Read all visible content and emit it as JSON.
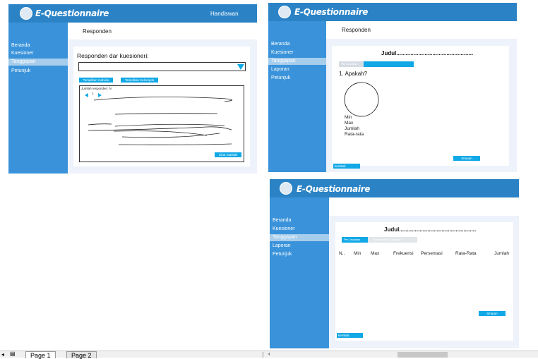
{
  "app": {
    "brand": "E-Questionnaire",
    "user": "Handiswan"
  },
  "nav": [
    "Beranda",
    "Kuesioner",
    "Tanggapan",
    "Laporan",
    "Petunjuk"
  ],
  "screen1": {
    "page_title": "Responden",
    "question_label": "Responden dar kuesioneri:",
    "btn_individu": "Tampilkan Individu",
    "btn_kelompok": "Tampilkan Kelompok",
    "count_label": "Jumlah responden: N",
    "pager_num": "1",
    "btn_statistik": "Lihat Statistik"
  },
  "screen2": {
    "page_title": "Responden",
    "title": "Judul.................................................",
    "tab1": "Per Jawaban",
    "question": "1. Apakah?",
    "stats": [
      "Min",
      "Max",
      "Jumlah",
      "Rata-rata"
    ],
    "btn_save": "Simpan",
    "btn_back": "kembali"
  },
  "screen3": {
    "title": "Judul.................................................",
    "tab1": "Per Jawaban",
    "tab2": "Keseluruhan Jawaban",
    "columns": [
      "N..",
      "Min",
      "Max",
      "Frekuensi",
      "Persentasi",
      "Rata-Rata",
      "Jumlah"
    ],
    "btn_save": "Simpan",
    "btn_back": "kembali"
  },
  "tabs": [
    "Page 1",
    "Page 2"
  ],
  "colors": {
    "header": "#2b83c6",
    "sidebar": "#3a93da",
    "accent": "#11a8e6",
    "main_bg": "#eef2fb"
  }
}
